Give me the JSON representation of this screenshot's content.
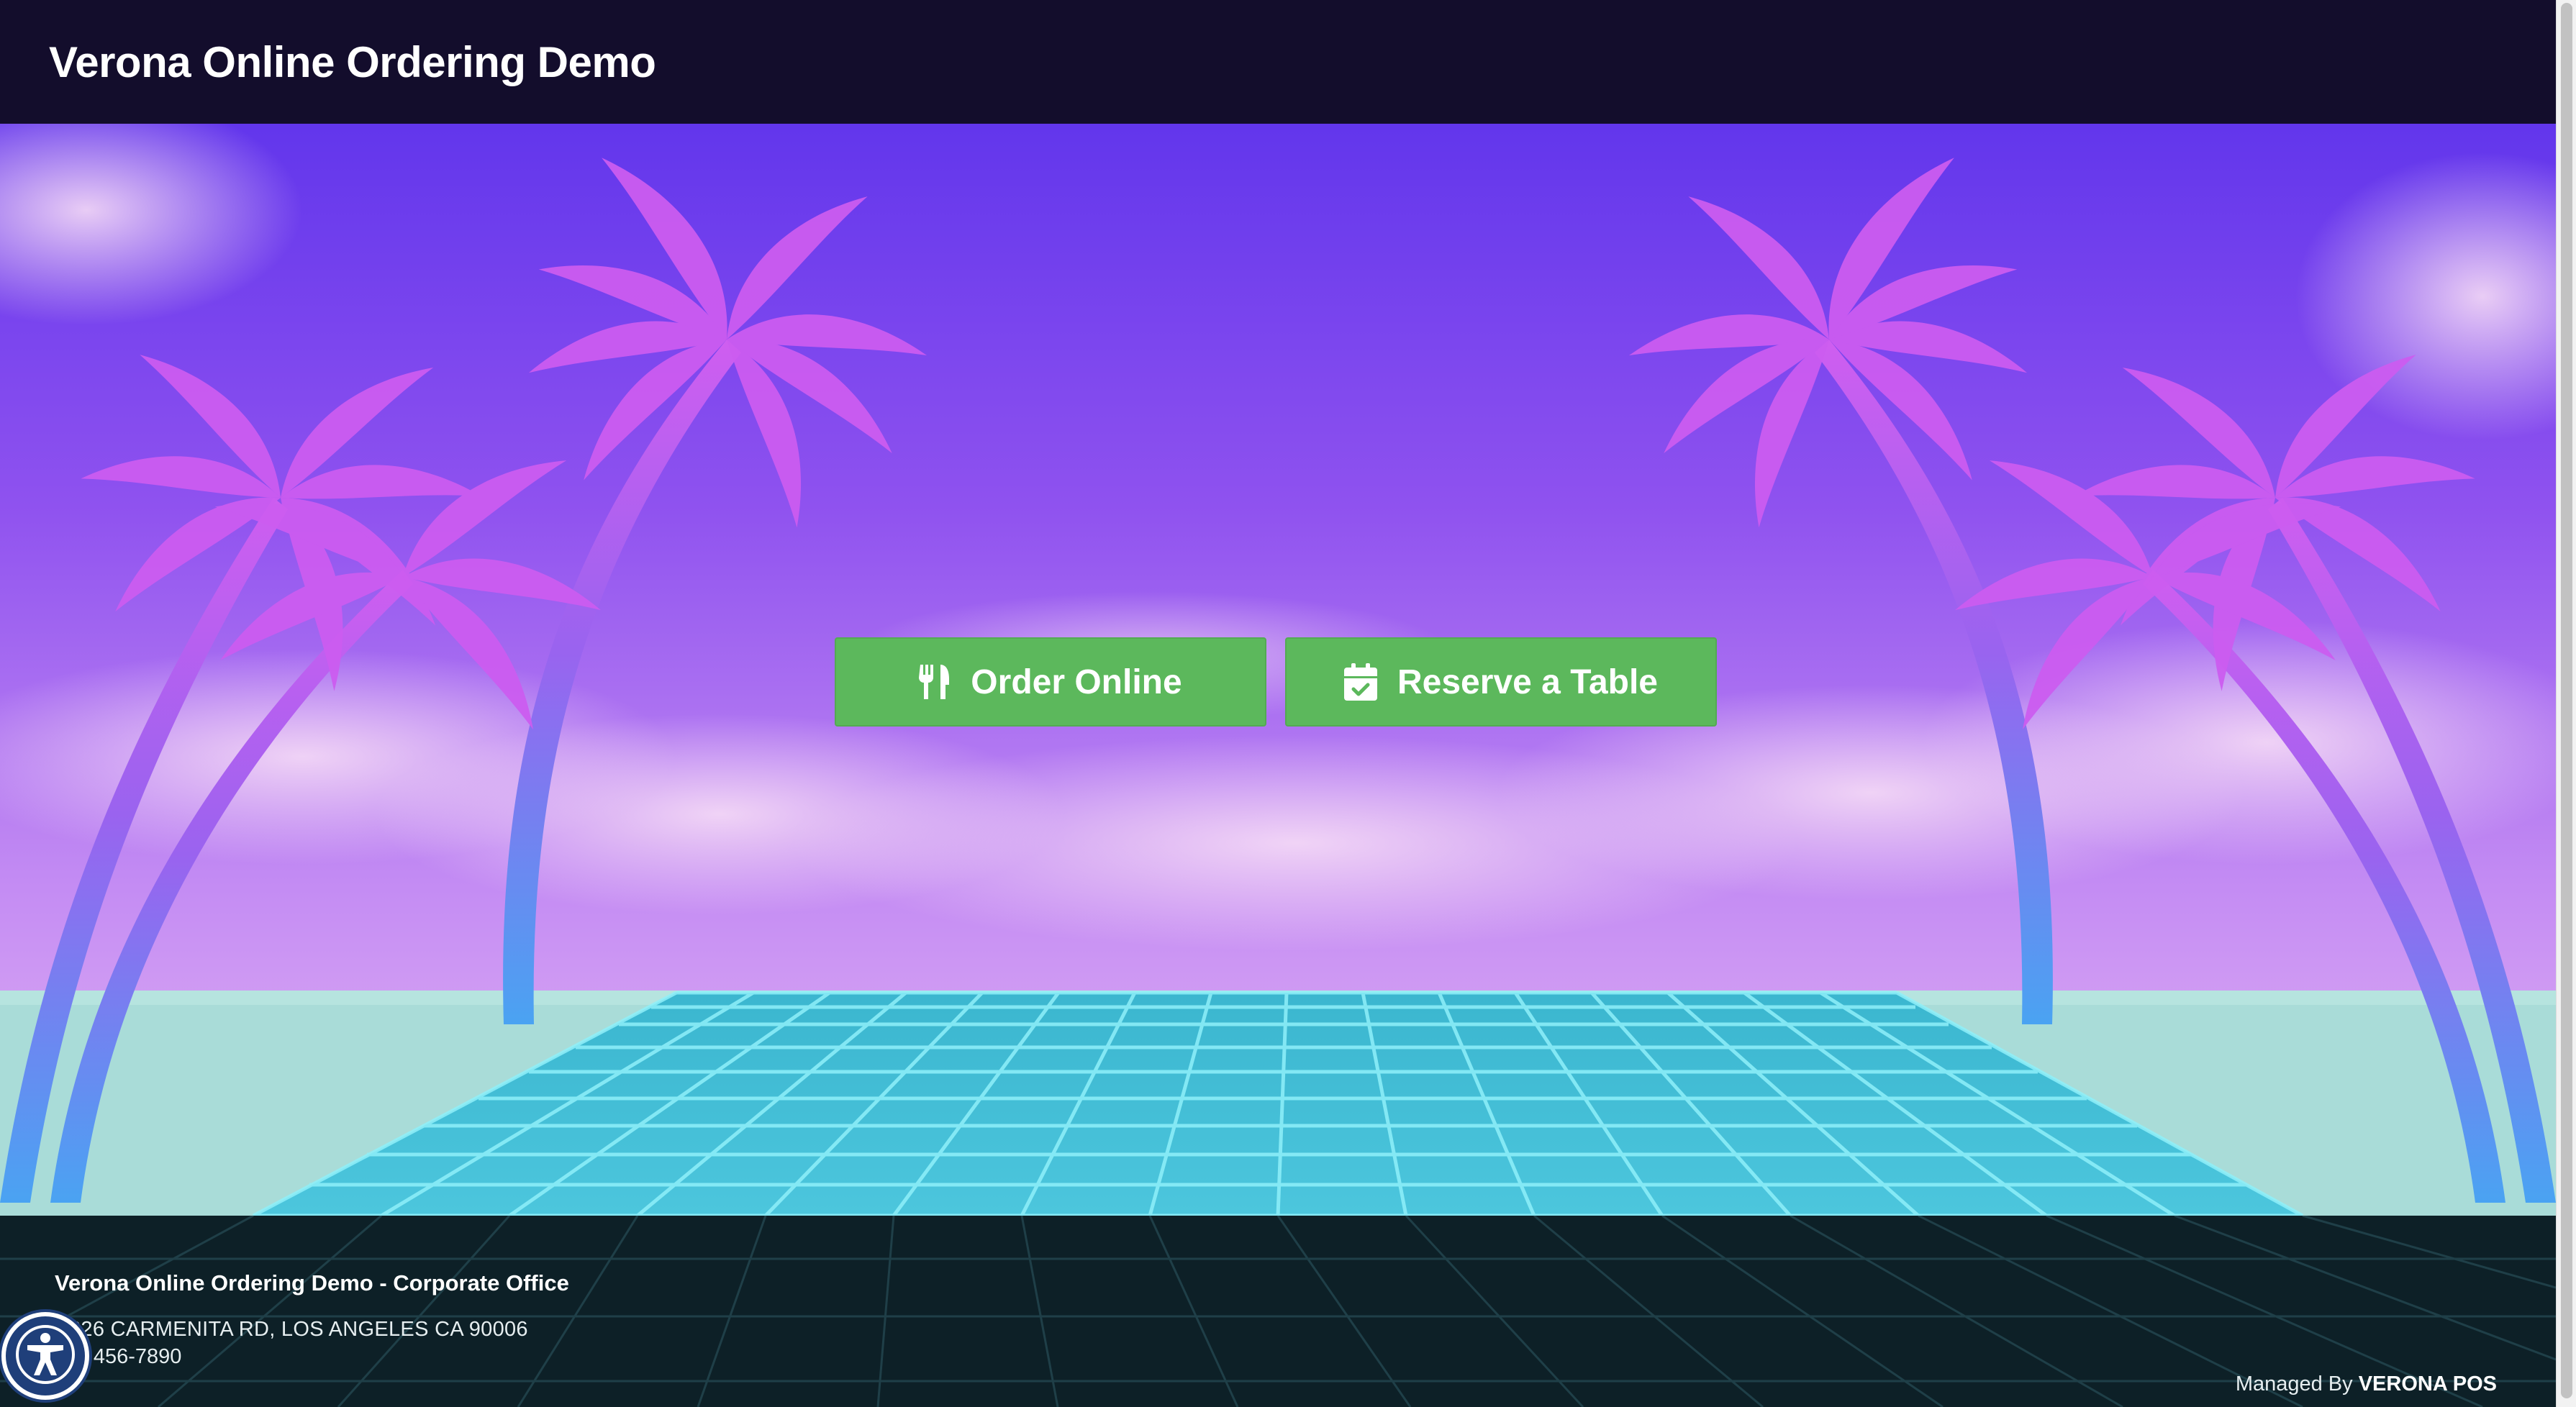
{
  "header": {
    "title": "Verona Online Ordering Demo"
  },
  "hero": {
    "background": "synthwave palm trees over a neon grid floor",
    "buttons": [
      {
        "label": "Order Online",
        "icon": "utensils-icon"
      },
      {
        "label": "Reserve a Table",
        "icon": "calendar-check-icon"
      }
    ]
  },
  "footer": {
    "office_name": "Verona Online Ordering Demo - Corporate Office",
    "address": "626 CARMENITA RD, LOS ANGELES CA 90006",
    "phone": "3) 456-7890",
    "managed_prefix": "Managed By",
    "managed_brand": "VERONA POS"
  },
  "accessibility": {
    "icon": "accessibility-icon"
  },
  "colors": {
    "header_bg": "#130d2c",
    "button_green": "#5cb85c",
    "footer_bg": "#0d2027",
    "sky_top": "#6a38ee",
    "sky_bottom": "#d9a8f2",
    "palm_pink": "#c85cf0",
    "palm_blue": "#4f9cf2",
    "grid_cyan": "#4ec3d6"
  }
}
